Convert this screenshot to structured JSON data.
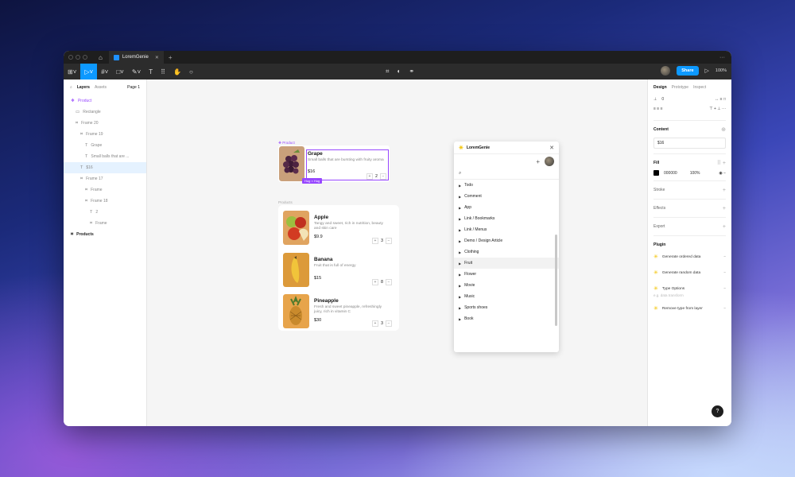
{
  "app": {
    "tab_title": "LoremGenie",
    "share_label": "Share",
    "zoom": "100%"
  },
  "left_panel": {
    "tabs": [
      "Layers",
      "Assets"
    ],
    "page": "Page 1",
    "layers": [
      {
        "label": "Product",
        "icon": "component-icon",
        "indent": 0,
        "style": "purple"
      },
      {
        "label": "Rectangle",
        "icon": "rectangle-icon",
        "indent": 1,
        "style": "normal"
      },
      {
        "label": "Frame 20",
        "icon": "frame-icon",
        "indent": 1,
        "style": "normal"
      },
      {
        "label": "Frame 19",
        "icon": "frame-icon",
        "indent": 2,
        "style": "normal"
      },
      {
        "label": "Grape",
        "icon": "text-icon",
        "indent": 3,
        "style": "normal"
      },
      {
        "label": "Small balls that are ...",
        "icon": "text-icon",
        "indent": 3,
        "style": "normal"
      },
      {
        "label": "$16",
        "icon": "text-icon",
        "indent": 2,
        "style": "selected"
      },
      {
        "label": "Frame 17",
        "icon": "frame-icon",
        "indent": 2,
        "style": "normal"
      },
      {
        "label": "Frame",
        "icon": "frame-icon",
        "indent": 3,
        "style": "normal"
      },
      {
        "label": "Frame 18",
        "icon": "frame-icon",
        "indent": 3,
        "style": "normal"
      },
      {
        "label": "2",
        "icon": "text-icon",
        "indent": 4,
        "style": "normal"
      },
      {
        "label": "Frame",
        "icon": "frame-icon",
        "indent": 4,
        "style": "normal"
      },
      {
        "label": "Products",
        "icon": "frame-icon",
        "indent": 0,
        "style": "dark"
      }
    ]
  },
  "right_panel": {
    "tabs": [
      "Design",
      "Prototype",
      "Inspect"
    ],
    "rotation": "0",
    "content_title": "Content",
    "content_value": "$16",
    "fill_title": "Fill",
    "fill_hex": "000000",
    "fill_opacity": "100%",
    "stroke_title": "Stroke",
    "effects_title": "Effects",
    "export_title": "Export",
    "plugin_title": "Plugin",
    "plugin_items": [
      {
        "label": "Generate ordered data"
      },
      {
        "label": "Generate random data"
      },
      {
        "label": "Type Options"
      },
      {
        "label": "Remove type from layer"
      }
    ],
    "type_options_hint": "e.g. data transform",
    "help": "?"
  },
  "canvas": {
    "product_label": "Product",
    "product": {
      "name": "Grape",
      "desc": "Small balls that are bursting with fruity aroma",
      "price": "$16",
      "qty": "2"
    },
    "hug_badge": "Hug × Hug",
    "products_label": "Products",
    "products": [
      {
        "name": "Apple",
        "desc": "Tangy and sweet, rich in nutrition, beauty and skin care",
        "price": "$9.9",
        "qty": "3"
      },
      {
        "name": "Banana",
        "desc": "Fruit that is full of energy",
        "price": "$15",
        "qty": "8"
      },
      {
        "name": "Pineapple",
        "desc": "Fresh and sweet pineapple, refreshingly juicy, rich in vitamin C",
        "price": "$30",
        "qty": "3"
      }
    ]
  },
  "plugin_window": {
    "title": "LoremGenie",
    "categories": [
      {
        "label": "Todo"
      },
      {
        "label": "Comment"
      },
      {
        "label": "App"
      },
      {
        "label": "Link / Bookmarks"
      },
      {
        "label": "Link / Menus"
      },
      {
        "label": "Demo / Design Article"
      },
      {
        "label": "Clothing"
      },
      {
        "label": "Fruit"
      },
      {
        "label": "Flower"
      },
      {
        "label": "Movie"
      },
      {
        "label": "Music"
      },
      {
        "label": "Sports shoes"
      },
      {
        "label": "Book"
      }
    ]
  },
  "colors": {
    "accent": "#0d99ff",
    "component": "#9747ff"
  }
}
